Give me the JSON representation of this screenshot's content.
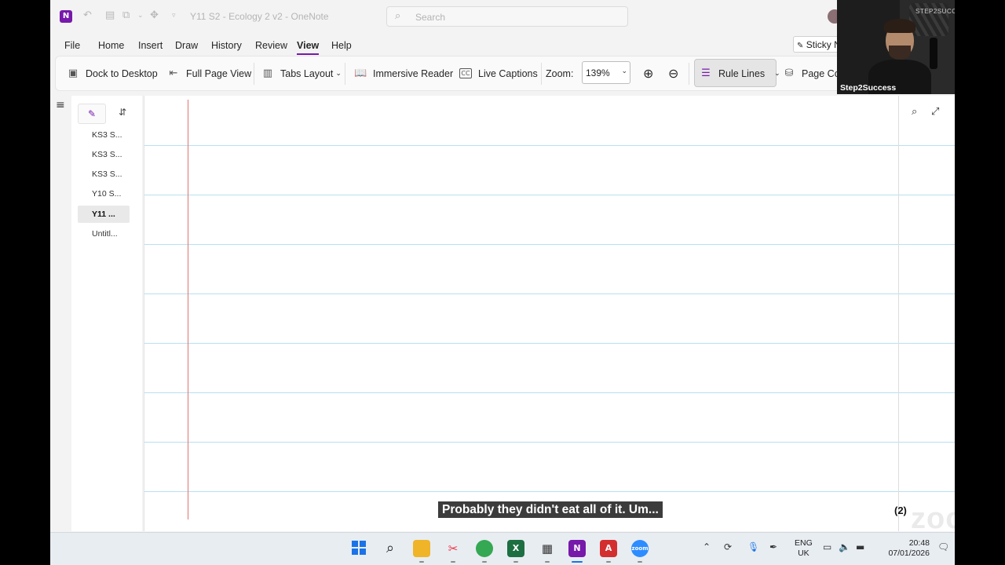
{
  "titlebar": {
    "title": "Y11 S2 - Ecology 2 v2  -  OneNote",
    "search_placeholder": "Search"
  },
  "menu": {
    "items": [
      "File",
      "Home",
      "Insert",
      "Draw",
      "History",
      "Review",
      "View",
      "Help"
    ],
    "active": "View",
    "sticky_label": "Sticky N"
  },
  "ribbon": {
    "dock": "Dock to Desktop",
    "fullpage": "Full Page View",
    "tabs_layout": "Tabs Layout",
    "immersive": "Immersive Reader",
    "captions": "Live Captions",
    "zoom_label": "Zoom:",
    "zoom_value": "139%",
    "rule_lines": "Rule Lines",
    "page_color": "Page Co"
  },
  "pages": {
    "items": [
      "KS3 S...",
      "KS3 S...",
      "KS3 S...",
      "Y10 S...",
      "Y11 ...",
      "Untitl..."
    ],
    "selected_index": 4
  },
  "caption": "Probably they didn't eat all of it. Um...",
  "canvas": {
    "mark": "(2)"
  },
  "watermark": "zoom",
  "webcam": {
    "brand": "STEP2SUCCESS",
    "name": "Step2Success"
  },
  "taskbar": {
    "lang_line1": "ENG",
    "lang_line2": "UK",
    "time": "20:48",
    "date": "07/01/2026"
  },
  "colors": {
    "accent": "#7719aa",
    "margin": "#e57373",
    "rule": "#b9dff0"
  }
}
